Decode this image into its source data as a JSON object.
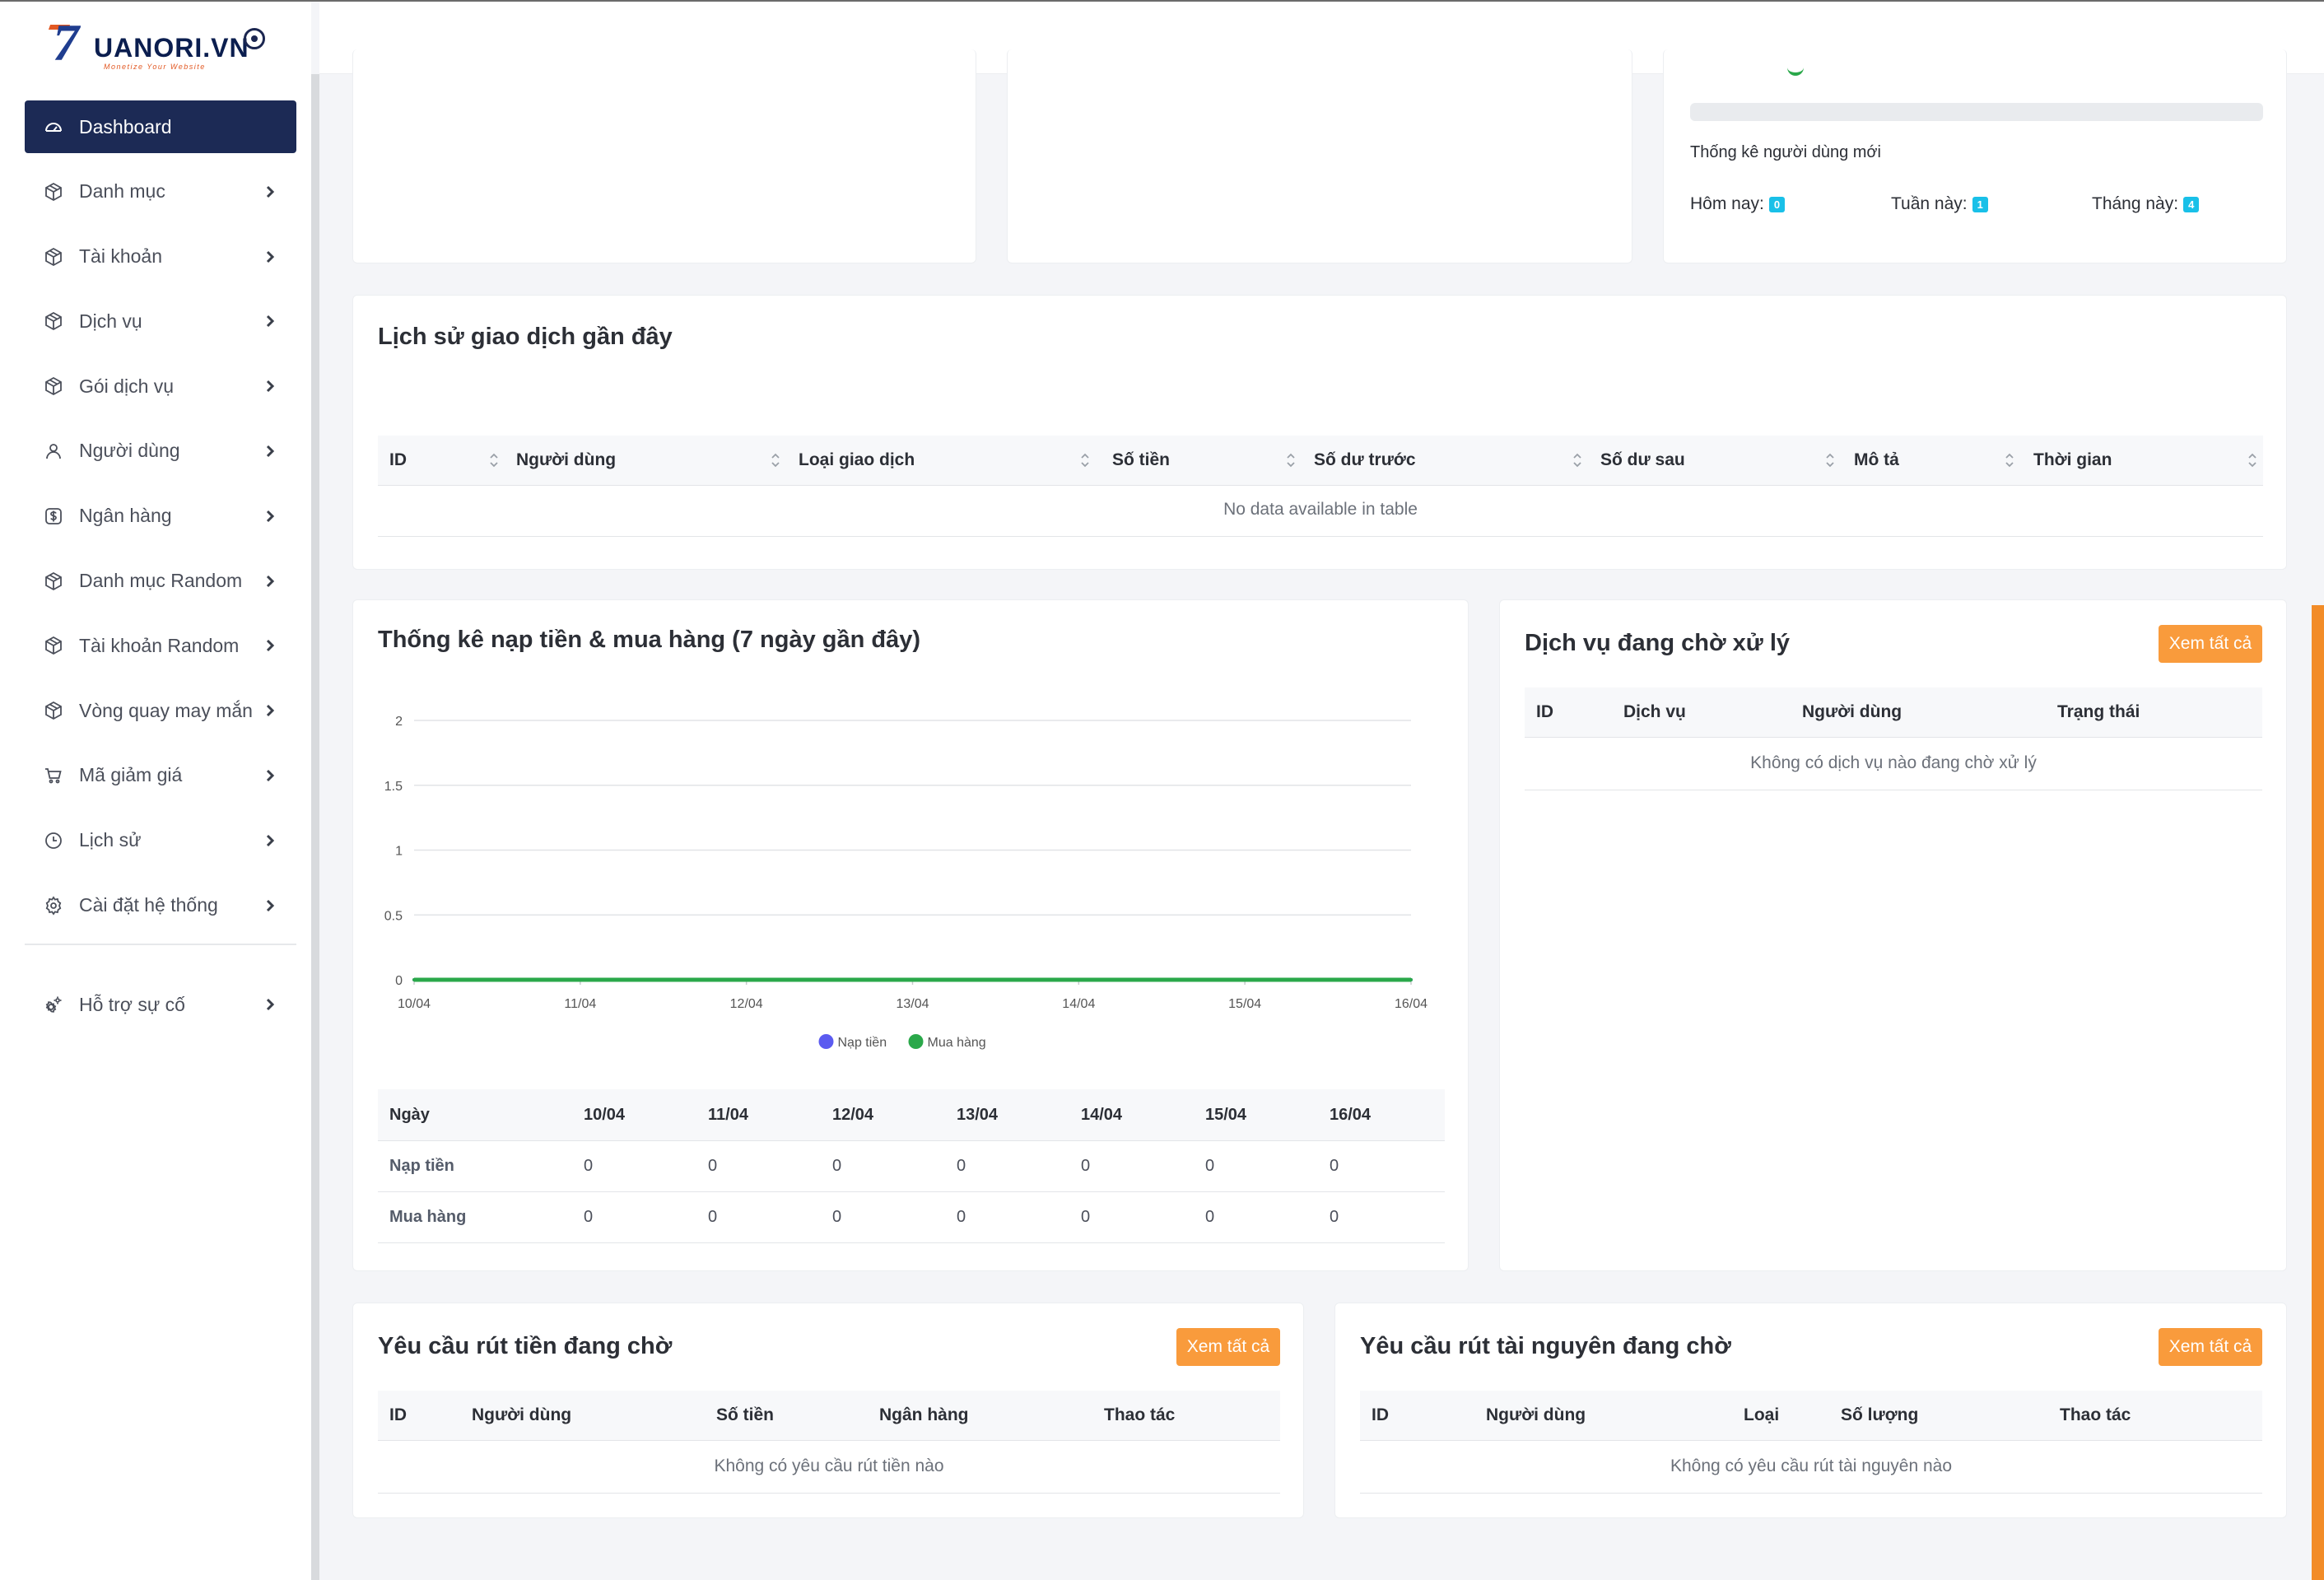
{
  "brand": {
    "name": "UANORI.VN",
    "tagline": "Monetize Your Website",
    "mark": "7"
  },
  "colors": {
    "sidebar_active": "#1c2a55",
    "accent": "#f99b3c",
    "badge": "#19c0e8",
    "series_nap": "#5b5bf0",
    "series_mua": "#2aa84a"
  },
  "sidebar": {
    "items": [
      {
        "label": "Dashboard",
        "icon": "dashboard-icon",
        "active": true
      },
      {
        "label": "Danh mục",
        "icon": "box-icon"
      },
      {
        "label": "Tài khoản",
        "icon": "box-icon"
      },
      {
        "label": "Dịch vụ",
        "icon": "box-icon"
      },
      {
        "label": "Gói dịch vụ",
        "icon": "box-icon"
      },
      {
        "label": "Người dùng",
        "icon": "user-icon"
      },
      {
        "label": "Ngân hàng",
        "icon": "dollar-icon"
      },
      {
        "label": "Danh mục Random",
        "icon": "box-icon"
      },
      {
        "label": "Tài khoản Random",
        "icon": "box-icon"
      },
      {
        "label": "Vòng quay may mắn",
        "icon": "box-icon"
      },
      {
        "label": "Mã giảm giá",
        "icon": "cart-icon"
      },
      {
        "label": "Lịch sử",
        "icon": "clock-icon"
      },
      {
        "label": "Cài đặt hệ thống",
        "icon": "gear-icon"
      }
    ],
    "support": {
      "label": "Hỗ trợ sự cố",
      "icon": "support-icon"
    }
  },
  "user_stats": {
    "title": "Thống kê người dùng mới",
    "today_label": "Hôm nay:",
    "today": "0",
    "week_label": "Tuần này:",
    "week": "1",
    "month_label": "Tháng này:",
    "month": "4"
  },
  "transactions": {
    "title": "Lịch sử giao dịch gần đây",
    "columns": [
      "ID",
      "Người dùng",
      "Loại giao dịch",
      "Số tiền",
      "Số dư trước",
      "Số dư sau",
      "Mô tả",
      "Thời gian"
    ],
    "empty": "No data available in table"
  },
  "stats_chart": {
    "title": "Thống kê nạp tiền & mua hàng (7 ngày gần đây)",
    "table": {
      "header": [
        "Ngày",
        "10/04",
        "11/04",
        "12/04",
        "13/04",
        "14/04",
        "15/04",
        "16/04"
      ],
      "rows": [
        {
          "label": "Nạp tiền",
          "values": [
            "0",
            "0",
            "0",
            "0",
            "0",
            "0",
            "0"
          ]
        },
        {
          "label": "Mua hàng",
          "values": [
            "0",
            "0",
            "0",
            "0",
            "0",
            "0",
            "0"
          ]
        }
      ]
    }
  },
  "chart_data": {
    "type": "line",
    "x": [
      "10/04",
      "11/04",
      "12/04",
      "13/04",
      "14/04",
      "15/04",
      "16/04"
    ],
    "series": [
      {
        "name": "Nạp tiền",
        "values": [
          0,
          0,
          0,
          0,
          0,
          0,
          0
        ]
      },
      {
        "name": "Mua hàng",
        "values": [
          0,
          0,
          0,
          0,
          0,
          0,
          0
        ]
      }
    ],
    "ylim": [
      0,
      2
    ],
    "yticks": [
      "0",
      "0.5",
      "1",
      "1.5",
      "2"
    ],
    "grid": true,
    "legend": "bottom"
  },
  "pending_services": {
    "title": "Dịch vụ đang chờ xử lý",
    "view_all": "Xem tất cả",
    "columns": [
      "ID",
      "Dịch vụ",
      "Người dùng",
      "Trạng thái"
    ],
    "empty": "Không có dịch vụ nào đang chờ xử lý"
  },
  "withdraw_money": {
    "title": "Yêu cầu rút tiền đang chờ",
    "view_all": "Xem tất cả",
    "columns": [
      "ID",
      "Người dùng",
      "Số tiền",
      "Ngân hàng",
      "Thao tác"
    ],
    "empty": "Không có yêu cầu rút tiền nào"
  },
  "withdraw_resource": {
    "title": "Yêu cầu rút tài nguyên đang chờ",
    "view_all": "Xem tất cả",
    "columns": [
      "ID",
      "Người dùng",
      "Loại",
      "Số lượng",
      "Thao tác"
    ],
    "empty": "Không có yêu cầu rút tài nguyên nào"
  }
}
